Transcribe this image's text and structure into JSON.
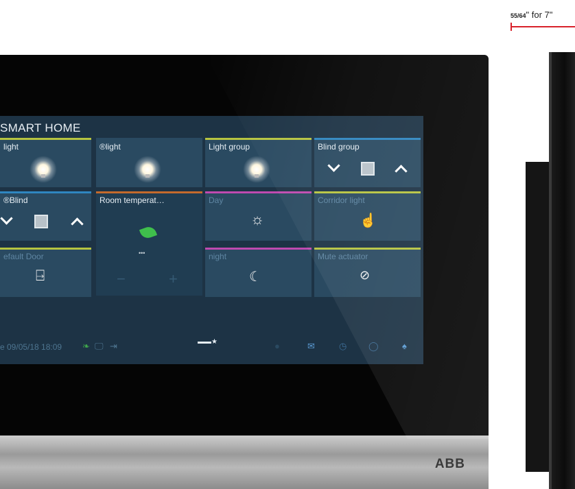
{
  "dimension": {
    "fraction": "55/64",
    "label_suffix": "\" for 7\""
  },
  "screen": {
    "title": "SMART HOME",
    "tiles": [
      {
        "label": "light",
        "icon": "bulb-icon",
        "bar": "#b7c440"
      },
      {
        "label": "®light",
        "icon": "bulb-icon",
        "bar": "#2a4a61"
      },
      {
        "label": "Light group",
        "icon": "bulb-group-icon",
        "bar": "#b7c440"
      },
      {
        "label": "Blind group",
        "icon": "blind-icon",
        "bar": "#2f86c0"
      },
      {
        "label": "®Blind",
        "icon": "blind-icon",
        "bar": "#2f86c0"
      },
      {
        "label": "Room temperat…",
        "icon": "leaf-icon",
        "bar": "#c46a2c"
      },
      {
        "label": "Day",
        "icon": "sun-icon",
        "bar": "#c04ab0"
      },
      {
        "label": "Corridor light",
        "icon": "hand-light-icon",
        "bar": "#b7c440"
      },
      {
        "label": "efault Door",
        "icon": "door-icon",
        "bar": "#b7c440"
      },
      {
        "label": "night",
        "icon": "moon-icon",
        "bar": "#c04ab0"
      },
      {
        "label": "Mute actuator",
        "icon": "mute-icon",
        "bar": "#b7c440"
      }
    ],
    "room_temp": {
      "dots": "•••",
      "minus": "−",
      "plus": "+"
    },
    "status": {
      "datetime": "e 09/05/18  18:09",
      "page_dots": "▬▬★"
    }
  },
  "logo": "ABB",
  "colors": {
    "screen_bg": "#1d3345",
    "tile_bg": "#2a4a61",
    "accent_red": "#d8202a"
  }
}
